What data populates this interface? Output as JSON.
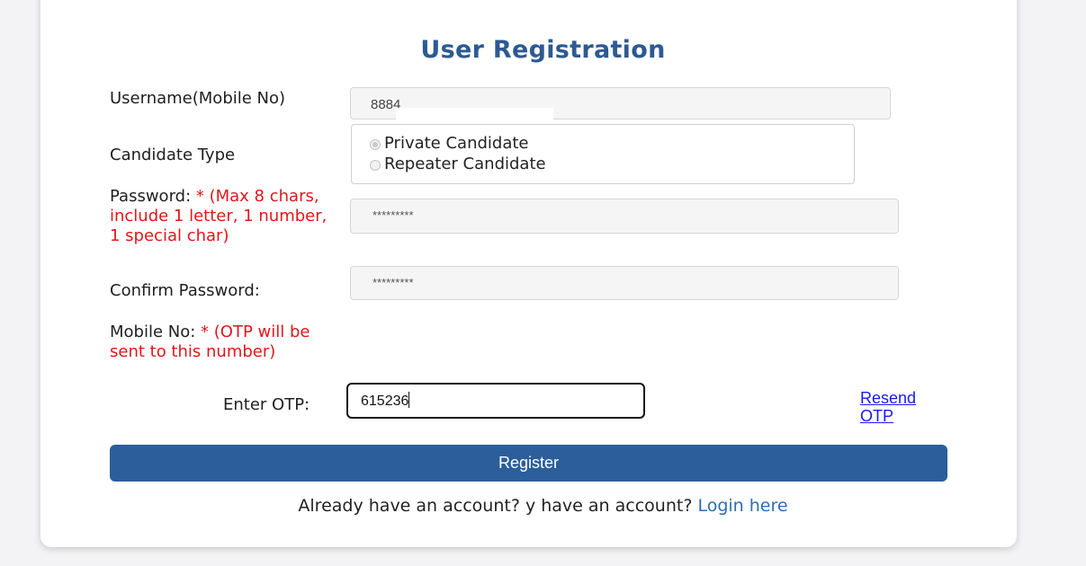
{
  "form": {
    "title": "User Registration",
    "username": {
      "label": "Username(Mobile No)",
      "value": "8884"
    },
    "candidate_type": {
      "label": "Candidate Type",
      "options": [
        "Private Candidate",
        "Repeater Candidate"
      ],
      "selected": "Private Candidate"
    },
    "password": {
      "label": "Password:",
      "hint": "* (Max 8 chars, include 1 letter, 1 number, 1 special char)",
      "value": "*********"
    },
    "confirm_password": {
      "label": "Confirm Password:",
      "value": "*********"
    },
    "mobile": {
      "label": "Mobile No:",
      "hint": "* (OTP will be sent to this number)"
    },
    "otp": {
      "label": "Enter OTP:",
      "value": "615236"
    },
    "resend_label": "Resend OTP",
    "register_label": "Register",
    "footer": {
      "text": "Already have an account? y have an account?",
      "login_label": "Login here"
    }
  },
  "colors": {
    "title": "#2c5a92",
    "required": "#e0161b",
    "button": "#2b5e9a",
    "link": "#1a1aee",
    "login_link": "#2d6db1"
  }
}
